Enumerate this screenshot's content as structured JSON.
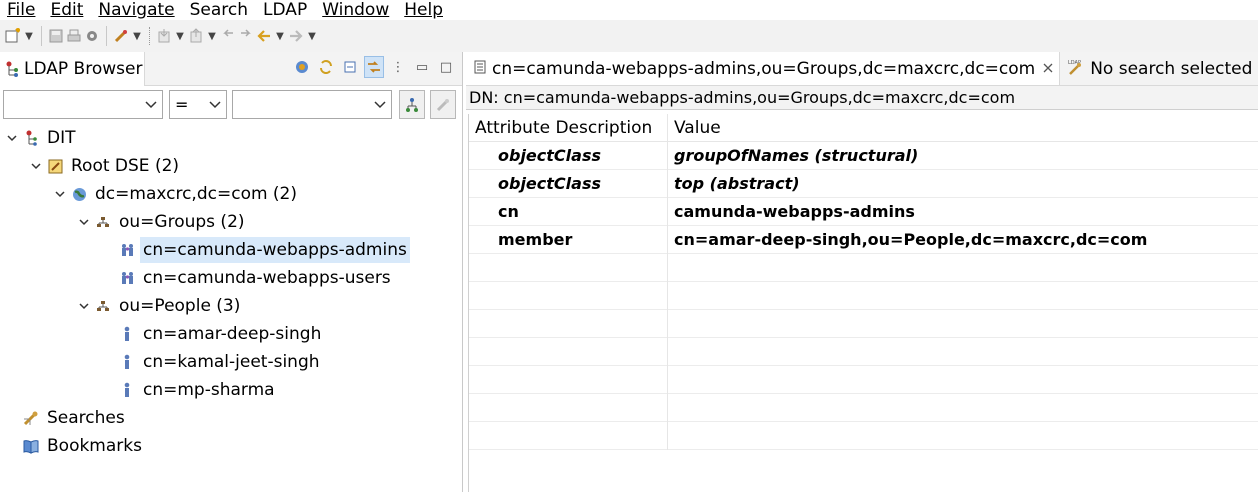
{
  "menu": {
    "file": "File",
    "edit": "Edit",
    "navigate": "Navigate",
    "search": "Search",
    "ldap": "LDAP",
    "window": "Window",
    "help": "Help"
  },
  "browser": {
    "tab_label": "LDAP Browser",
    "filter_operator": "=",
    "tree": {
      "dit": "DIT",
      "root_dse": "Root DSE (2)",
      "domain": "dc=maxcrc,dc=com (2)",
      "groups": "ou=Groups (2)",
      "group_admins": "cn=camunda-webapps-admins",
      "group_users": "cn=camunda-webapps-users",
      "people": "ou=People (3)",
      "person_1": "cn=amar-deep-singh",
      "person_2": "cn=kamal-jeet-singh",
      "person_3": "cn=mp-sharma",
      "searches": "Searches",
      "bookmarks": "Bookmarks"
    }
  },
  "editor": {
    "active_tab": "cn=camunda-webapps-admins,ou=Groups,dc=maxcrc,dc=com",
    "search_tab": "No search selected",
    "dn_line": "DN: cn=camunda-webapps-admins,ou=Groups,dc=maxcrc,dc=com",
    "columns": {
      "attribute": "Attribute Description",
      "value": "Value"
    },
    "rows": [
      {
        "attribute": "objectClass",
        "value": "groupOfNames (structural)"
      },
      {
        "attribute": "objectClass",
        "value": "top (abstract)"
      },
      {
        "attribute": "cn",
        "value": "camunda-webapps-admins"
      },
      {
        "attribute": "member",
        "value": "cn=amar-deep-singh,ou=People,dc=maxcrc,dc=com"
      }
    ]
  },
  "icons": {
    "new": "new-icon",
    "save": "save-icon",
    "print": "print-icon",
    "settings": "gear-icon",
    "run": "rocket-icon",
    "import": "import-icon",
    "export": "export-icon",
    "back": "back-icon",
    "forward": "forward-icon"
  }
}
